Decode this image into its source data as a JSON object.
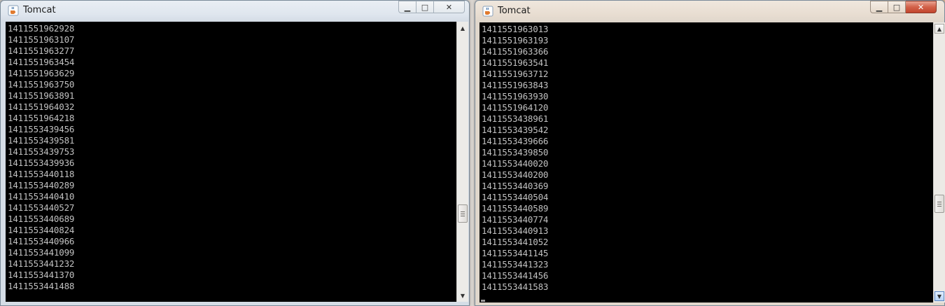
{
  "windows": [
    {
      "title": "Tomcat",
      "caption_buttons": {
        "minimize": "▁",
        "maximize": "□",
        "close": "✕"
      },
      "lines": [
        "1411551962928",
        "1411551963107",
        "1411551963277",
        "1411551963454",
        "1411551963629",
        "1411551963750",
        "1411551963891",
        "1411551964032",
        "1411551964218",
        "1411553439456",
        "1411553439581",
        "1411553439753",
        "1411553439936",
        "1411553440118",
        "1411553440289",
        "1411553440410",
        "1411553440527",
        "1411553440689",
        "1411553440824",
        "1411553440966",
        "1411553441099",
        "1411553441232",
        "1411553441370",
        "1411553441488"
      ],
      "scroll_up": "▲",
      "scroll_down": "▼"
    },
    {
      "title": "Tomcat",
      "caption_buttons": {
        "minimize": "▁",
        "maximize": "□",
        "close": "✕"
      },
      "lines": [
        "1411551963013",
        "1411551963193",
        "1411551963366",
        "1411551963541",
        "1411551963712",
        "1411551963843",
        "1411551963930",
        "1411551964120",
        "1411553438961",
        "1411553439542",
        "1411553439666",
        "1411553439850",
        "1411553440020",
        "1411553440200",
        "1411553440369",
        "1411553440504",
        "1411553440589",
        "1411553440774",
        "1411553440913",
        "1411553441052",
        "1411553441145",
        "1411553441323",
        "1411553441456",
        "1411553441583"
      ],
      "scroll_up": "▲",
      "scroll_down": "▼"
    }
  ],
  "colors": {
    "console_bg": "#000000",
    "console_text": "#c0c0c0"
  },
  "icons": {
    "app": "java-coffee-cup-icon"
  }
}
